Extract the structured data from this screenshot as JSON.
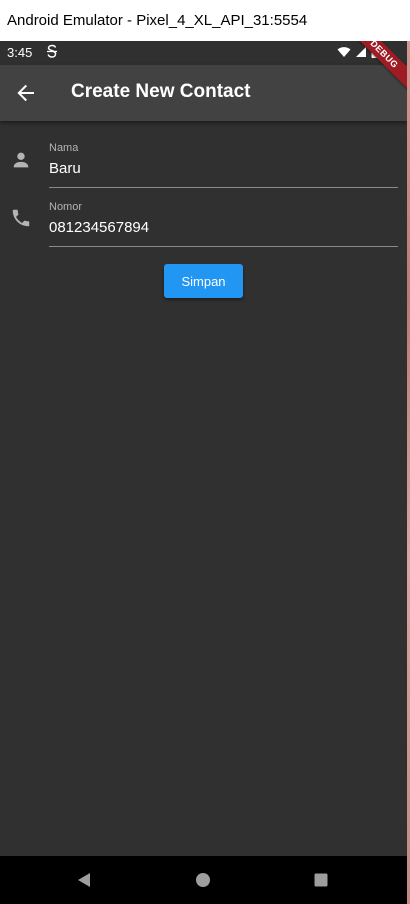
{
  "window": {
    "title": "Android Emulator - Pixel_4_XL_API_31:5554"
  },
  "statusbar": {
    "time": "3:45",
    "icons": [
      "wifi-icon",
      "signal-icon",
      "battery-icon"
    ]
  },
  "appbar": {
    "back_icon": "arrow-left-icon",
    "title": "Create New Contact",
    "debug_banner": "DEBUG"
  },
  "form": {
    "name": {
      "icon": "person-icon",
      "label": "Nama",
      "value": "Baru"
    },
    "phone": {
      "icon": "phone-icon",
      "label": "Nomor",
      "value": "081234567894"
    },
    "save_label": "Simpan"
  },
  "navbar": {
    "items": [
      "back-triangle-icon",
      "home-circle-icon",
      "recents-square-icon"
    ]
  },
  "colors": {
    "background": "#303030",
    "appbar": "#424242",
    "accent": "#2196f3",
    "debug": "#a01c24"
  }
}
